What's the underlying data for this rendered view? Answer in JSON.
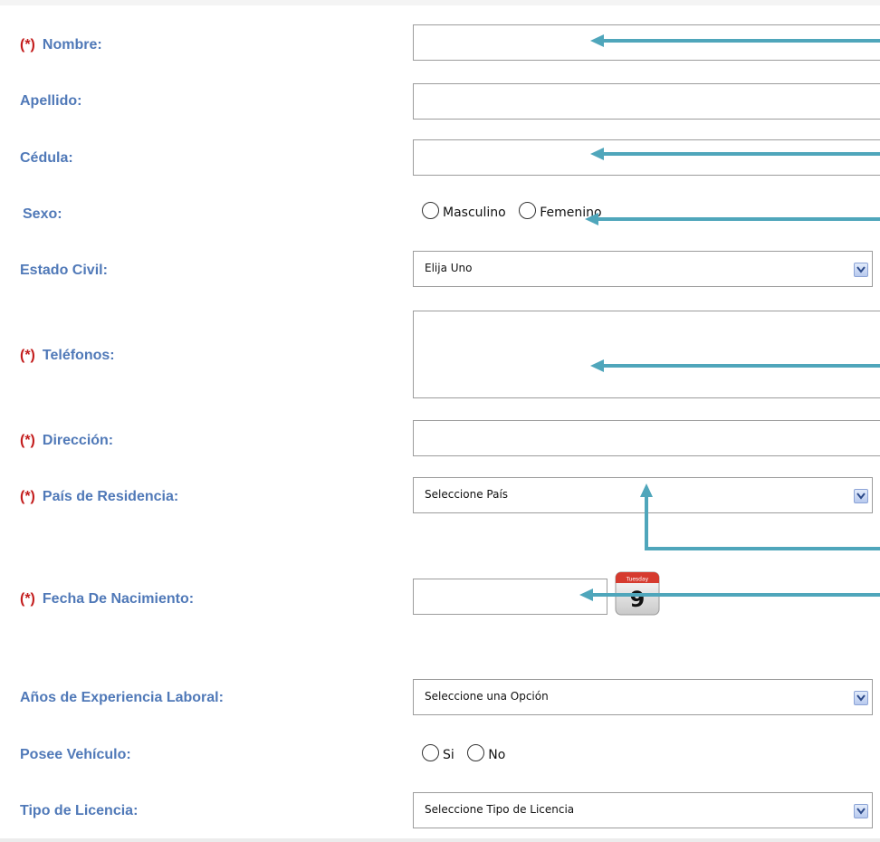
{
  "form": {
    "required_marker": "(*)",
    "nombre": {
      "label": "Nombre:",
      "value": ""
    },
    "apellido": {
      "label": "Apellido:",
      "value": ""
    },
    "cedula": {
      "label": "Cédula:",
      "value": ""
    },
    "sexo": {
      "label": "Sexo:",
      "options": [
        "Masculino",
        "Femenino"
      ]
    },
    "estado_civil": {
      "label": "Estado Civil:",
      "selected": "Elija Uno"
    },
    "telefonos": {
      "label": "Teléfonos:",
      "value": ""
    },
    "direccion": {
      "label": "Dirección:",
      "value": ""
    },
    "pais": {
      "label": "País de Residencia:",
      "selected": "Seleccione País"
    },
    "fecha_nacimiento": {
      "label": "Fecha De Nacimiento:",
      "value": "",
      "calendar_header": "Tuesday",
      "calendar_day": "9"
    },
    "experiencia": {
      "label": "Años de Experiencia Laboral:",
      "selected": "Seleccione una Opción"
    },
    "vehiculo": {
      "label": "Posee Vehículo:",
      "options": [
        "Si",
        "No"
      ]
    },
    "licencia": {
      "label": "Tipo de Licencia:",
      "selected": "Seleccione Tipo de Licencia"
    }
  },
  "icons": {
    "select_arrow": "chevron-down-icon",
    "calendar": "calendar-icon",
    "annotation": "arrow-left-icon"
  },
  "colors": {
    "label": "#5079b8",
    "required": "#c31d1d",
    "annotation_arrow": "#4fa6bb",
    "border": "#9c9c9c"
  }
}
